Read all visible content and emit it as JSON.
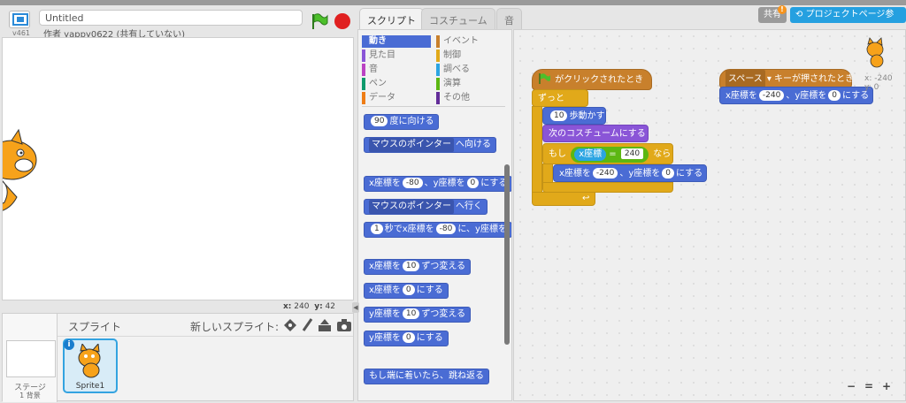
{
  "project": {
    "version": "v461",
    "title": "Untitled",
    "author": "作者 yappy0622 (共有していない)"
  },
  "stage": {
    "coords_x_label": "x:",
    "coords_x": "240",
    "coords_y_label": "y:",
    "coords_y": "42"
  },
  "sprites_pane": {
    "title": "スプライト",
    "new_sprite_label": "新しいスプライト:",
    "stage_label": "ステージ",
    "stage_backdrops": "1 背景",
    "sprite_name": "Sprite1",
    "info": "i"
  },
  "tabs": [
    "スクリプト",
    "コスチューム",
    "音"
  ],
  "categories": [
    {
      "label": "動き",
      "color": "#4a6cd4"
    },
    {
      "label": "イベント",
      "color": "#c8802c"
    },
    {
      "label": "見た目",
      "color": "#8a55d7"
    },
    {
      "label": "制御",
      "color": "#e1a91a"
    },
    {
      "label": "音",
      "color": "#bb42c3"
    },
    {
      "label": "調べる",
      "color": "#2ca5e2"
    },
    {
      "label": "ペン",
      "color": "#0e9a6c"
    },
    {
      "label": "演算",
      "color": "#5cb712"
    },
    {
      "label": "データ",
      "color": "#ee7d16"
    },
    {
      "label": "その他",
      "color": "#632d99"
    }
  ],
  "palette": {
    "point_dir_val": "90",
    "point_dir": "度に向ける",
    "point_towards_drop": "マウスのポインター",
    "point_towards": "へ向ける",
    "goto_x_label": "x座標を",
    "goto_x_val": "-80",
    "goto_y_label": "、y座標を",
    "goto_y_val": "0",
    "goto_end": "にする",
    "goto_drop": "マウスのポインター",
    "goto_to": "へ行く",
    "glide_secs": "1",
    "glide_label": "秒でx座標を",
    "glide_x": "-80",
    "glide_rest": "に、y座標を",
    "change_x_label": "x座標を",
    "change_x_val": "10",
    "change_x_end": "ずつ変える",
    "set_x_label": "x座標を",
    "set_x_val": "0",
    "set_x_end": "にする",
    "change_y_label": "y座標を",
    "change_y_val": "10",
    "change_y_end": "ずつ変える",
    "set_y_label": "y座標を",
    "set_y_val": "0",
    "set_y_end": "にする",
    "bounce": "もし端に着いたら、跳ね返る"
  },
  "script1": {
    "hat": "がクリックされたとき",
    "forever": "ずっと",
    "move_val": "10",
    "move": "歩動かす",
    "next_costume": "次のコスチュームにする",
    "if": "もし",
    "cond_var": "x座標",
    "cond_op": "=",
    "cond_val": "240",
    "then": "なら",
    "goto_x_label": "x座標を",
    "goto_x_val": "-240",
    "goto_y_label": "、y座標を",
    "goto_y_val": "0",
    "goto_end": "にする",
    "loop_arrow": "↩"
  },
  "script2": {
    "key_drop": "スペース",
    "hat": "キーが押されたとき",
    "goto_x_label": "x座標を",
    "goto_x_val": "-240",
    "goto_y_label": "、y座標を",
    "goto_y_val": "0",
    "goto_end": "にする"
  },
  "topright": {
    "share": "共有",
    "share_badge": "!",
    "project_page": "プロジェクトページ参"
  },
  "sprite_corner": {
    "x": "x: -240",
    "y": "y: 0"
  },
  "zoom": [
    "−",
    "=",
    "+"
  ]
}
